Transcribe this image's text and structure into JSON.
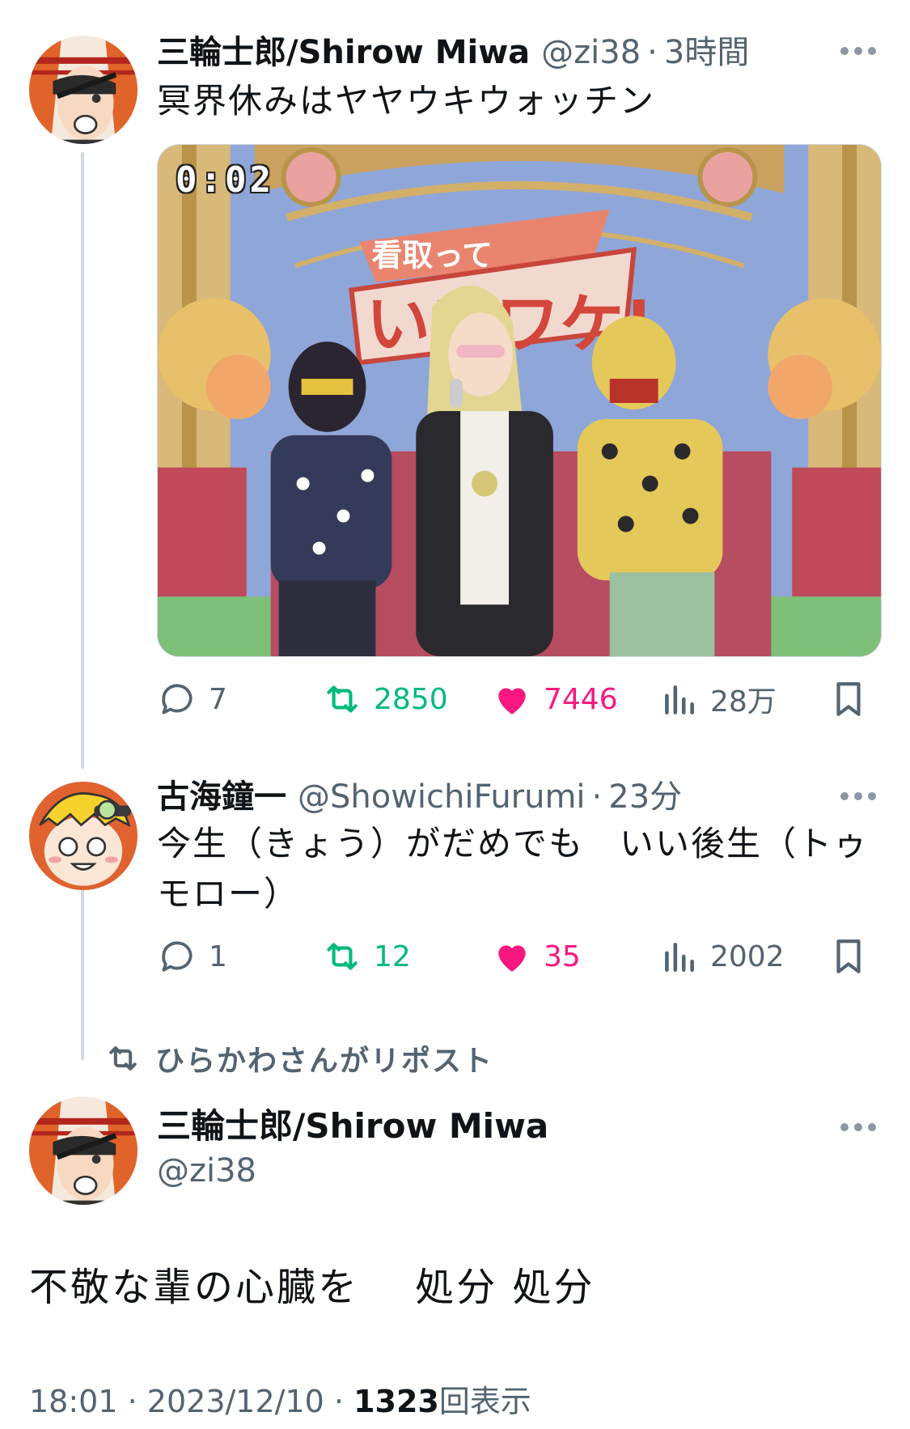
{
  "thread": {
    "tweets": [
      {
        "name": "三輪士郎/Shirow Miwa",
        "handle": "@zi38",
        "separator": "·",
        "time": "3時間",
        "text": "冥界休みはヤヤウキウォッチン",
        "media": {
          "type": "video",
          "timestamp": "0:02",
          "sign_text_1": "看取って",
          "sign_text_2": "いいワケ!"
        },
        "stats": {
          "replies": "7",
          "retweets": "2850",
          "likes": "7446",
          "views": "28万"
        }
      },
      {
        "name": "古海鐘一",
        "handle": "@ShowichiFurumi",
        "separator": "·",
        "time": "23分",
        "text": "今生（きょう）がだめでも　いい後生（トゥモロー）",
        "stats": {
          "replies": "1",
          "retweets": "12",
          "likes": "35",
          "views": "2002"
        }
      }
    ]
  },
  "repost_banner": "ひらかわさんがリポスト",
  "main_tweet": {
    "name": "三輪士郎/Shirow Miwa",
    "handle": "@zi38",
    "text": "不敬な輩の心臓を　 処分 処分",
    "time": "18:01",
    "date": "2023/12/10",
    "separator": "·",
    "view_count": "1323",
    "view_label": "回表示"
  },
  "icons": {
    "reply": "reply-icon",
    "retweet": "retweet-icon",
    "like": "heart-icon",
    "views": "views-chart-icon",
    "bookmark": "bookmark-icon",
    "more": "more-icon"
  },
  "colors": {
    "text": "#0f1419",
    "secondary": "#536471",
    "retweet_green": "#00ba7c",
    "like_pink": "#f91880",
    "thread_line": "#cfd9de"
  }
}
